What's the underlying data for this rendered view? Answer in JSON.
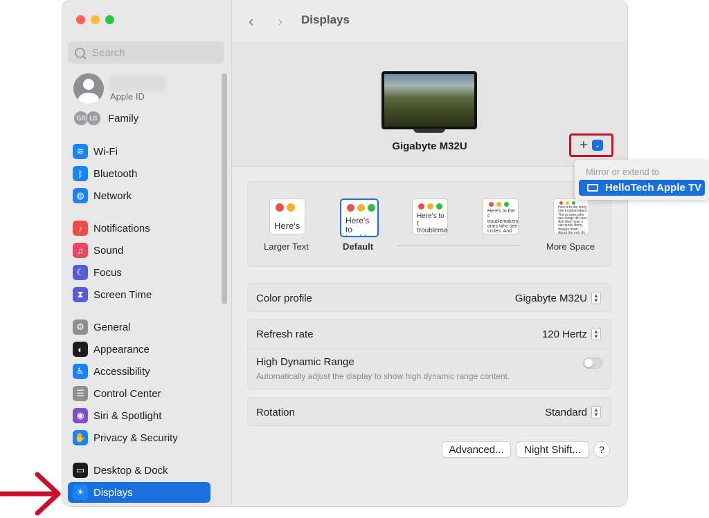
{
  "window": {
    "title": "Displays",
    "traffic_lights": {
      "close": "#ff5f57",
      "minimize": "#febc2e",
      "zoom": "#28c840"
    }
  },
  "sidebar": {
    "search_placeholder": "Search",
    "apple_id_label": "Apple ID",
    "family": {
      "label": "Family",
      "avatars": [
        "GB",
        "LB"
      ]
    },
    "items": [
      {
        "label": "Wi-Fi",
        "icon": "wifi-icon",
        "color": "#1a82fb",
        "glyph": "≋"
      },
      {
        "label": "Bluetooth",
        "icon": "bluetooth-icon",
        "color": "#1a82fb",
        "glyph": "ᛒ"
      },
      {
        "label": "Network",
        "icon": "globe-icon",
        "color": "#1a82fb",
        "glyph": "◍"
      },
      {
        "label": "Notifications",
        "icon": "bell-icon",
        "color": "#ef4d4d",
        "glyph": "♪"
      },
      {
        "label": "Sound",
        "icon": "speaker-icon",
        "color": "#ee4560",
        "glyph": "♫"
      },
      {
        "label": "Focus",
        "icon": "moon-icon",
        "color": "#5a5bd6",
        "glyph": "☾"
      },
      {
        "label": "Screen Time",
        "icon": "hourglass-icon",
        "color": "#5a5bd6",
        "glyph": "⧗"
      },
      {
        "label": "General",
        "icon": "gear-icon",
        "color": "#8e8e93",
        "glyph": "⚙"
      },
      {
        "label": "Appearance",
        "icon": "appearance-icon",
        "color": "#1c1c1e",
        "glyph": "◐"
      },
      {
        "label": "Accessibility",
        "icon": "accessibility-icon",
        "color": "#1a82fb",
        "glyph": "♿"
      },
      {
        "label": "Control Center",
        "icon": "toggles-icon",
        "color": "#8e8e93",
        "glyph": "☰"
      },
      {
        "label": "Siri & Spotlight",
        "icon": "siri-icon",
        "color": "#7a4fd0",
        "glyph": "◉"
      },
      {
        "label": "Privacy & Security",
        "icon": "hand-icon",
        "color": "#1a82fb",
        "glyph": "✋"
      },
      {
        "label": "Desktop & Dock",
        "icon": "dock-icon",
        "color": "#1c1c1e",
        "glyph": "▭"
      },
      {
        "label": "Displays",
        "icon": "sun-icon",
        "color": "#1a82fb",
        "glyph": "☀",
        "selected": true
      }
    ]
  },
  "main": {
    "display_name": "Gigabyte M32U",
    "add_button_glyph": "+",
    "dropdown": {
      "header": "Mirror or extend to",
      "item": "HelloTech Apple TV"
    },
    "resolution": {
      "options": [
        {
          "label": "Larger Text",
          "sample": "Here's"
        },
        {
          "label": "Default",
          "sample": "Here's to troublem"
        },
        {
          "label": "",
          "sample": "Here's to t troublema ones who"
        },
        {
          "label": "",
          "sample": "Here's to the c troublemakers. ones who see t rules. And they"
        },
        {
          "label": "More Space",
          "sample": "Here's to the crazy one troublemakers. The ro ones who see things dif rules. And they have n can quote them, disagre them. About the only thi Because they change thi"
        }
      ]
    },
    "color_profile": {
      "label": "Color profile",
      "value": "Gigabyte M32U"
    },
    "refresh_rate": {
      "label": "Refresh rate",
      "value": "120 Hertz"
    },
    "hdr": {
      "label": "High Dynamic Range",
      "description": "Automatically adjust the display to show high dynamic range content.",
      "enabled": false
    },
    "rotation": {
      "label": "Rotation",
      "value": "Standard"
    },
    "buttons": {
      "advanced": "Advanced...",
      "night_shift": "Night Shift...",
      "help": "?"
    }
  },
  "accent_colors": {
    "selection": "#1a6fde",
    "highlight_box": "#c8102e"
  }
}
